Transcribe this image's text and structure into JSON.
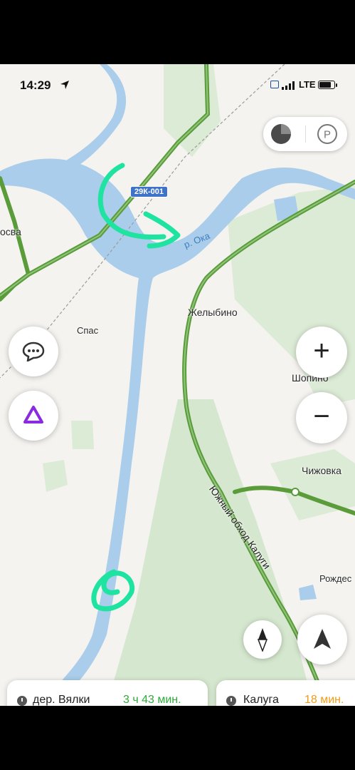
{
  "status_bar": {
    "time": "14:29",
    "network": "LTE"
  },
  "map": {
    "badge": "29К-001",
    "river": "р. Ока",
    "road": "Южный обход Калуги",
    "places": [
      {
        "id": "osva",
        "name": "осва"
      },
      {
        "id": "spas",
        "name": "Спас"
      },
      {
        "id": "zhelybino",
        "name": "Желыбино"
      },
      {
        "id": "shopino",
        "name": "Шопино"
      },
      {
        "id": "chizhovka",
        "name": "Чижовка"
      },
      {
        "id": "rozhdestveno",
        "name": "Рождес"
      }
    ]
  },
  "controls": {
    "zoom_in": "+",
    "zoom_out": "−",
    "layers_icon": "layers-icon",
    "parking_label": "P"
  },
  "routes": [
    {
      "destination": "дер. Вялки",
      "eta": "3 ч 43 мин.",
      "eta_color": "#2eaa3a"
    },
    {
      "destination": "Калуга",
      "eta": "18 мин.",
      "eta_color": "#f29b18"
    }
  ],
  "colors": {
    "water": "#a9cdea",
    "forest": "#d5e8cf",
    "road": "#5a9b3a",
    "annotation": "#1fe3a0"
  }
}
